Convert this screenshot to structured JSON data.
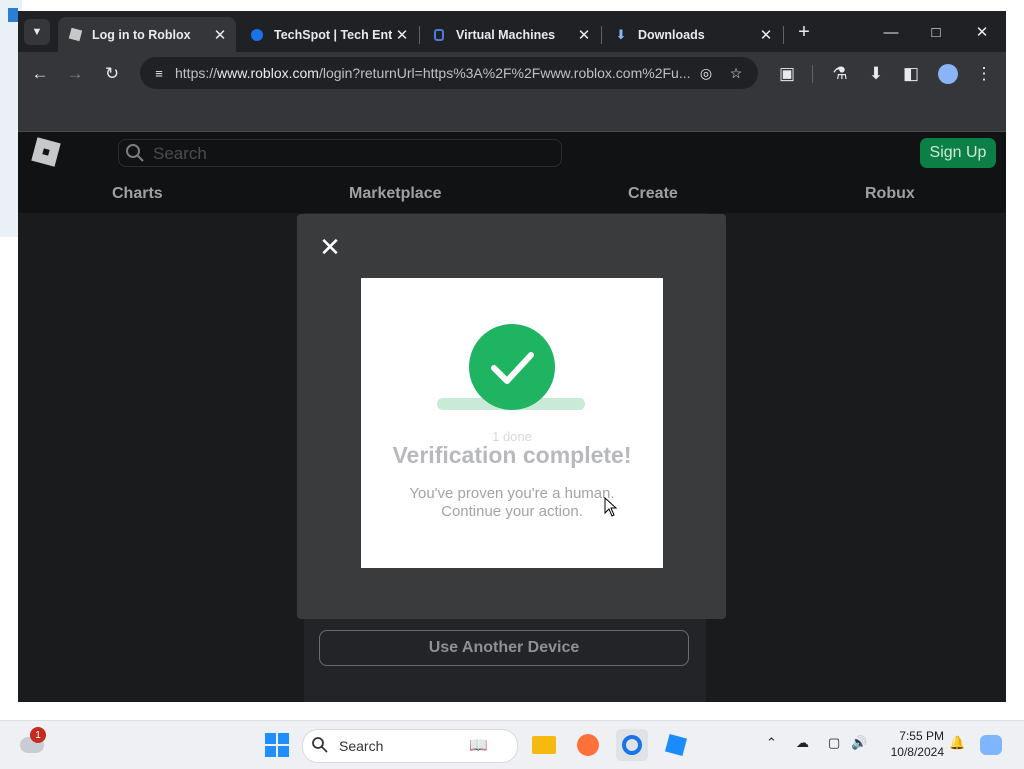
{
  "browser": {
    "tabs": [
      {
        "title": "Log in to Roblox",
        "icon": "roblox-favicon",
        "active": true
      },
      {
        "title": "TechSpot | Tech Ent",
        "icon": "techspot-favicon",
        "active": false
      },
      {
        "title": "Virtual Machines",
        "icon": "hyperv-favicon",
        "active": false
      },
      {
        "title": "Downloads",
        "icon": "download-icon",
        "active": false
      }
    ],
    "url_prefix": "https://",
    "url_domain": "www.roblox.com",
    "url_rest": "/login?returnUrl=https%3A%2F%2Fwww.roblox.com%2Fu..."
  },
  "roblox": {
    "search_placeholder": "Search",
    "signup_label": "Sign Up",
    "nav": [
      "Charts",
      "Marketplace",
      "Create",
      "Robux"
    ],
    "another_device_label": "Use Another Device"
  },
  "captcha": {
    "progress": "1 done",
    "title": "Verification complete!",
    "line1": "You've proven you're a human.",
    "line2": "Continue your action.",
    "success_color": "#1fb461"
  },
  "taskbar": {
    "notification_count": "1",
    "search_label": "Search",
    "time": "7:55 PM",
    "date": "10/8/2024"
  }
}
